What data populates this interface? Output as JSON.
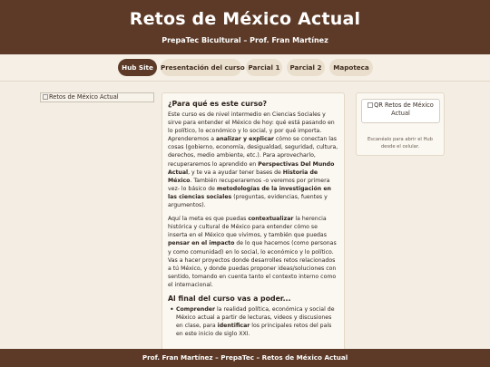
{
  "header": {
    "title": "Retos de México Actual",
    "subtitle": "PrepaTec Bicultural – Prof. Fran Martínez"
  },
  "nav": {
    "tabs": [
      {
        "label": "Hub Site",
        "active": true
      },
      {
        "label": "Presentación del curso",
        "active": false
      },
      {
        "label": "Parcial 1",
        "active": false
      },
      {
        "label": "Parcial 2",
        "active": false
      },
      {
        "label": "Mapoteca",
        "active": false
      }
    ]
  },
  "main": {
    "left_image_alt": "Retos de México Actual",
    "card": {
      "heading": "¿Para qué es este curso?",
      "p1": [
        {
          "t": "Este curso es de nivel intermedio en Ciencias Sociales y sirve para entender el México de hoy: qué está pasando en lo político, lo económico y lo social, y por qué importa. Aprenderemos a "
        },
        {
          "t": "analizar y explicar",
          "b": true
        },
        {
          "t": " cómo se conectan las cosas (gobierno, economía, desigualdad, seguridad, cultura, derechos, medio ambiente, etc.). Para aprovecharlo, recuperaremos lo aprendido en "
        },
        {
          "t": "Perspectivas Del Mundo Actual",
          "b": true
        },
        {
          "t": ", y te va a ayudar tener bases de "
        },
        {
          "t": "Historia de México",
          "b": true
        },
        {
          "t": ". También recuperaremos -o veremos por primera vez- lo básico de "
        },
        {
          "t": "metodologías de la investigación en las ciencias sociales",
          "b": true
        },
        {
          "t": " (preguntas, evidencias, fuentes y argumentos)."
        }
      ],
      "p2": [
        {
          "t": "Aquí la meta es que puedas "
        },
        {
          "t": "contextualizar",
          "b": true
        },
        {
          "t": " la herencia histórica y cultural de México para entender cómo se inserta en el México que vivimos, y también que puedas "
        },
        {
          "t": "pensar en el impacto",
          "b": true
        },
        {
          "t": " de lo que hacemos (como personas y como comunidad) en lo social, lo económico y lo político. Vas a hacer proyectos donde desarrolles retos relacionados a tú México, y donde puedas proponer ideas/soluciones con sentido, tomando en cuenta tanto el contexto interno como el internacional."
        }
      ],
      "heading2": "Al final del curso vas a poder...",
      "list": [
        [
          {
            "t": "Comprender",
            "b": true
          },
          {
            "t": " la realidad política, económica y social de México actual a partir de lecturas, videos y discusiones en clase, para "
          },
          {
            "t": "identificar",
            "b": true
          },
          {
            "t": " los principales retos del país en este inicio de siglo XXI."
          }
        ]
      ]
    },
    "qr": {
      "alt": "QR Retos de México Actual",
      "caption": "Escanéalo para abrir el Hub desde el celular."
    }
  },
  "footer": {
    "text": "Prof. Fran Martínez – PrepaTec – Retos de México Actual"
  },
  "colors": {
    "brand_brown": "#5c3a27",
    "background": "#f3ede3",
    "pill": "#eadfcd"
  }
}
